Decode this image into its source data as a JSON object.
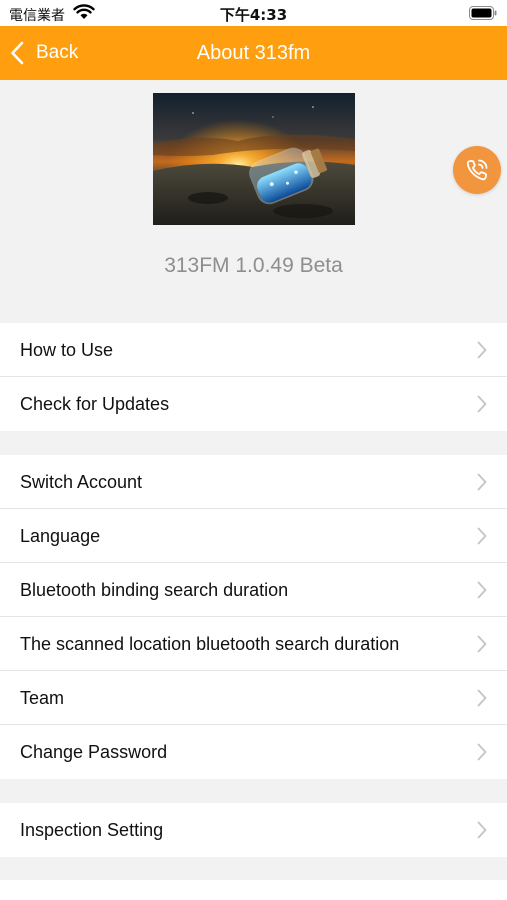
{
  "status_bar": {
    "carrier": "電信業者",
    "time": "下午4:33"
  },
  "nav": {
    "back_label": "Back",
    "title": "About 313fm"
  },
  "about": {
    "version": "313FM 1.0.49 Beta"
  },
  "menu_groups": [
    {
      "items": [
        {
          "label": "How to Use"
        },
        {
          "label": "Check for Updates"
        }
      ]
    },
    {
      "items": [
        {
          "label": "Switch Account"
        },
        {
          "label": "Language"
        },
        {
          "label": "Bluetooth binding search duration"
        },
        {
          "label": "The scanned location bluetooth search duration"
        },
        {
          "label": "Team"
        },
        {
          "label": "Change Password"
        }
      ]
    },
    {
      "items": [
        {
          "label": "Inspection Setting"
        }
      ]
    }
  ],
  "icons": {
    "back": "chevron-left-icon",
    "call": "phone-call-icon",
    "row_arrow": "chevron-right-icon",
    "wifi": "wifi-icon",
    "battery": "battery-icon"
  },
  "colors": {
    "accent": "#ff9f0f",
    "call_button": "#f2953f",
    "background": "#f2f2f2",
    "version_text": "#8e8e8e"
  }
}
